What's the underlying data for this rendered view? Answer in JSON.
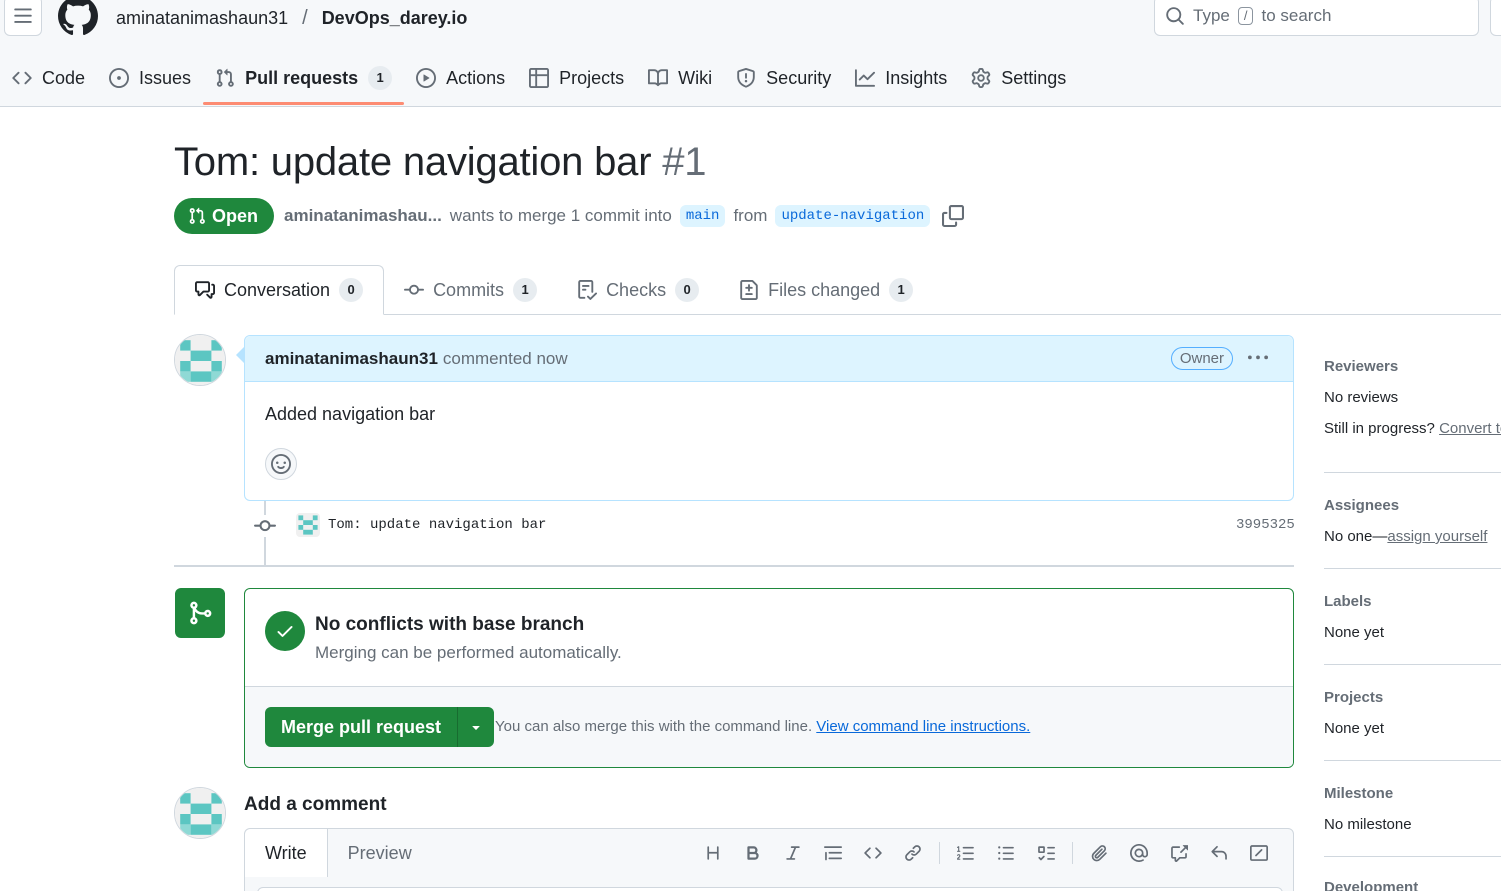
{
  "header": {
    "owner": "aminatanimashaun31",
    "separator": "/",
    "repo": "DevOps_darey.io",
    "search": {
      "prefix": "Type",
      "key": "/",
      "suffix": "to search"
    }
  },
  "repo_nav": [
    {
      "label": "Code",
      "icon": "code-icon"
    },
    {
      "label": "Issues",
      "icon": "issue-icon"
    },
    {
      "label": "Pull requests",
      "icon": "pull-request-icon",
      "count": "1",
      "selected": true
    },
    {
      "label": "Actions",
      "icon": "play-icon"
    },
    {
      "label": "Projects",
      "icon": "table-icon"
    },
    {
      "label": "Wiki",
      "icon": "book-icon"
    },
    {
      "label": "Security",
      "icon": "shield-icon"
    },
    {
      "label": "Insights",
      "icon": "graph-icon"
    },
    {
      "label": "Settings",
      "icon": "gear-icon"
    }
  ],
  "pr": {
    "title": "Tom: update navigation bar",
    "number": "#1",
    "state": "Open",
    "author": "aminatanimashau...",
    "merge_text": "wants to merge 1 commit into",
    "base_branch": "main",
    "from_text": "from",
    "head_branch": "update-navigation"
  },
  "tabs": [
    {
      "label": "Conversation",
      "count": "0",
      "active": true
    },
    {
      "label": "Commits",
      "count": "1"
    },
    {
      "label": "Checks",
      "count": "0"
    },
    {
      "label": "Files changed",
      "count": "1"
    }
  ],
  "comment": {
    "author": "aminatanimashaun31",
    "action": "commented now",
    "badge": "Owner",
    "body": "Added navigation bar"
  },
  "commit": {
    "message": "Tom: update navigation bar",
    "sha": "3995325"
  },
  "merge": {
    "title": "No conflicts with base branch",
    "subtitle": "Merging can be performed automatically.",
    "button": "Merge pull request",
    "note": "You can also merge this with the command line.",
    "link": "View command line instructions."
  },
  "add_comment": {
    "title": "Add a comment",
    "write_tab": "Write",
    "preview_tab": "Preview"
  },
  "sidebar": {
    "reviewers": {
      "title": "Reviewers",
      "value": "No reviews",
      "progress_text": "Still in progress?",
      "progress_link": "Convert to draft"
    },
    "assignees": {
      "title": "Assignees",
      "value": "No one—",
      "link": "assign yourself"
    },
    "labels": {
      "title": "Labels",
      "value": "None yet"
    },
    "projects": {
      "title": "Projects",
      "value": "None yet"
    },
    "milestone": {
      "title": "Milestone",
      "value": "No milestone"
    },
    "development": {
      "title": "Development"
    }
  },
  "colors": {
    "accent_green": "#1f883d",
    "link_blue": "#0969da",
    "nav_underline": "#fd8c73",
    "comment_header": "#ddf4ff"
  }
}
